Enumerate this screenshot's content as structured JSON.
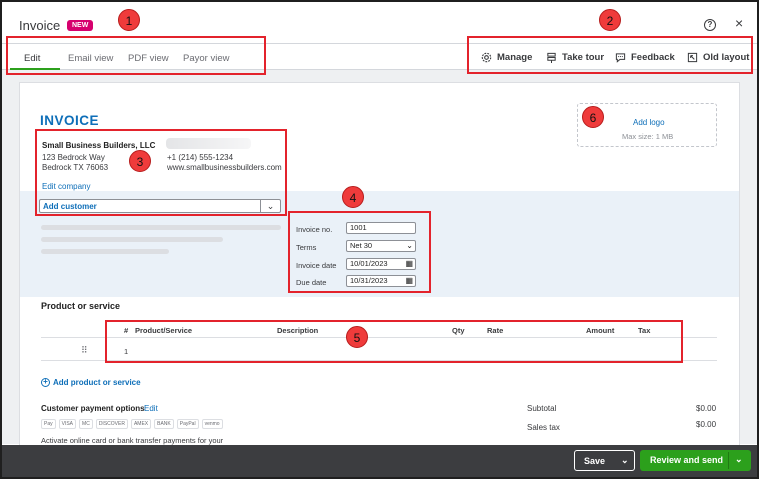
{
  "header": {
    "title": "Invoice",
    "badge": "NEW",
    "help_symbol": "?",
    "close_symbol": "×"
  },
  "tabs": [
    {
      "label": "Edit",
      "active": true
    },
    {
      "label": "Email view"
    },
    {
      "label": "PDF view"
    },
    {
      "label": "Payor view"
    }
  ],
  "toolbar": {
    "manage": "Manage",
    "take_tour": "Take tour",
    "feedback": "Feedback",
    "old_layout": "Old layout"
  },
  "annotations": [
    "1",
    "2",
    "3",
    "4",
    "5",
    "6"
  ],
  "invoice": {
    "heading": "INVOICE",
    "logo": {
      "add_label": "Add logo",
      "max_size": "Max size: 1 MB"
    },
    "company": {
      "name": "Small Business Builders, LLC",
      "street": "123 Bedrock Way",
      "city": "Bedrock TX 76063",
      "phone": "+1 (214) 555-1234",
      "website": "www.smallbusinessbuilders.com",
      "edit_label": "Edit company"
    },
    "customer": {
      "placeholder": "Add customer",
      "chevron": "⌄"
    },
    "fields": {
      "invoice_no_label": "Invoice no.",
      "invoice_no": "1001",
      "terms_label": "Terms",
      "terms": "Net 30",
      "invoice_date_label": "Invoice date",
      "invoice_date": "10/01/2023",
      "due_date_label": "Due date",
      "due_date": "10/31/2023"
    },
    "products": {
      "section_title": "Product or service",
      "columns": {
        "num": "#",
        "product": "Product/Service",
        "description": "Description",
        "qty": "Qty",
        "rate": "Rate",
        "amount": "Amount",
        "tax": "Tax"
      },
      "rows": [
        {
          "num": "1"
        }
      ],
      "add_label": "Add product or service"
    },
    "payment": {
      "title": "Customer payment options",
      "edit": "Edit",
      "methods": [
        "Pay",
        "VISA",
        "MC",
        "DISCOVER",
        "AMEX",
        "BANK",
        "PayPal",
        "venmo"
      ],
      "description": "Activate online card or bank transfer payments for your"
    },
    "totals": {
      "subtotal_label": "Subtotal",
      "subtotal": "$0.00",
      "tax_label": "Sales tax",
      "tax": "$0.00"
    }
  },
  "footer": {
    "save": "Save",
    "review_send": "Review and send"
  },
  "colors": {
    "accent": "#2ca01c",
    "link": "#0d6eb8",
    "annotation": "#e3232c",
    "new_badge": "#d6006e"
  }
}
